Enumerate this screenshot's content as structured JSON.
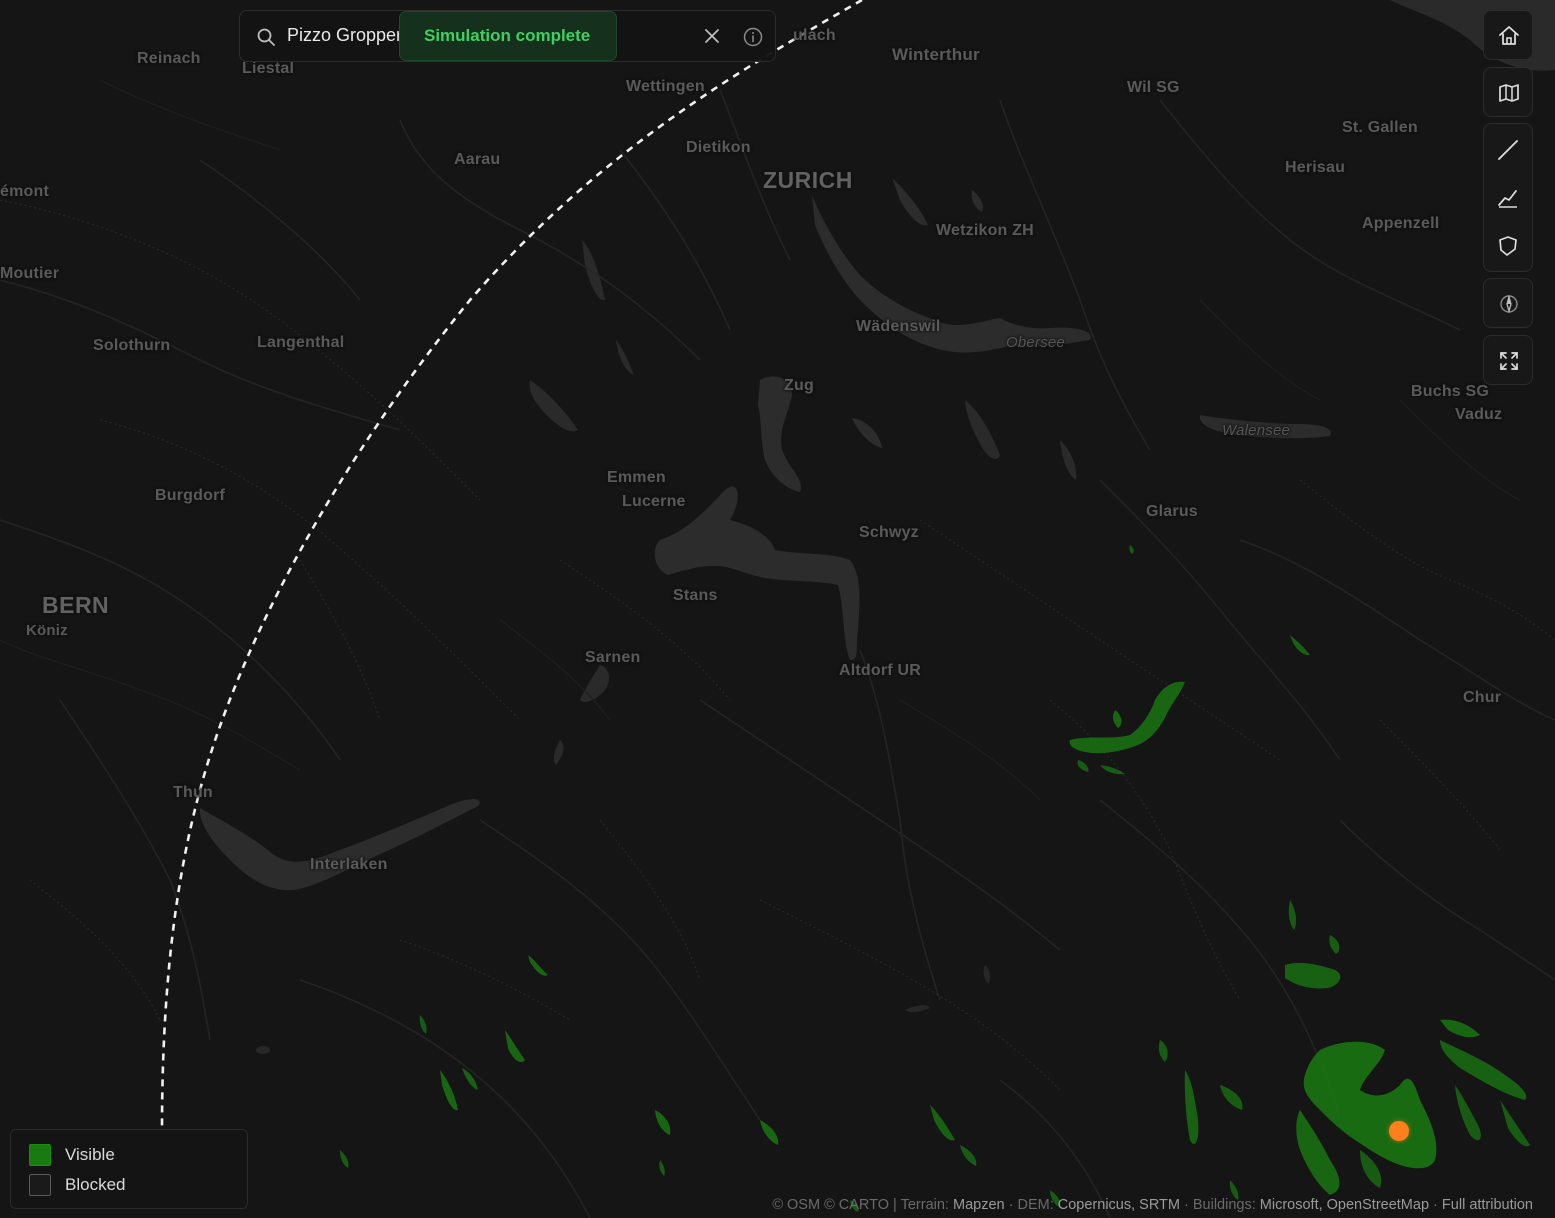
{
  "search": {
    "value": "Pizzo Groppera",
    "status": "Simulation complete"
  },
  "colors": {
    "visible": "#1a7a12",
    "blocked": "#1a1a1a",
    "observer": "#ff7f1c",
    "status_text": "#3fcf62"
  },
  "toolbar": {
    "icons": [
      "home-icon",
      "map-icon",
      "ruler-icon",
      "elevation-profile-icon",
      "polygon-icon",
      "compass-icon",
      "fullscreen-icon"
    ]
  },
  "legend": {
    "items": [
      {
        "label": "Visible",
        "color": "#1a7a12"
      },
      {
        "label": "Blocked",
        "color": "#1a1a1a"
      }
    ]
  },
  "attribution": {
    "prefix": "© OSM © CARTO |",
    "terrain_label": "Terrain:",
    "terrain_source": "Mapzen",
    "dem_label": "DEM:",
    "dem_source": "Copernicus, SRTM",
    "buildings_label": "Buildings:",
    "buildings_source": "Microsoft, OpenStreetMap",
    "full_link": "Full attribution"
  },
  "places": [
    "Reinach",
    "Liestal",
    "Wettingen",
    "Winterthur",
    "Wil SG",
    "St. Gallen",
    "Herisau",
    "Aarau",
    "Dietikon",
    "ZURICH",
    "Wetzikon ZH",
    "Appenzell",
    "Moutier",
    "Solothurn",
    "Langenthal",
    "Wädenswil",
    "Obersee",
    "Zug",
    "Buchs SG",
    "Vaduz",
    "Walensee",
    "Burgdorf",
    "Emmen",
    "Lucerne",
    "Schwyz",
    "Glarus",
    "BERN",
    "Köniz",
    "Stans",
    "Sarnen",
    "Altdorf UR",
    "Chur",
    "Thun",
    "Interlaken",
    "ulach",
    "émont"
  ]
}
